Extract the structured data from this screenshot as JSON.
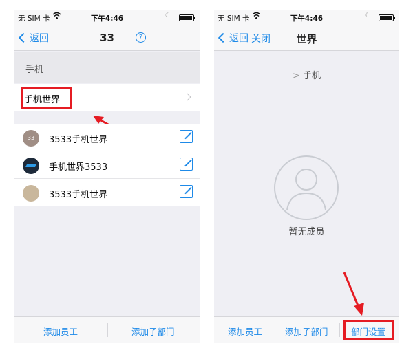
{
  "status_bar": {
    "carrier": "无 SIM 卡",
    "time": "下午4:46"
  },
  "left_screen": {
    "back_label": "返回",
    "title": "33",
    "breadcrumb": "手机",
    "department_name": "手机世界",
    "members": [
      {
        "avatar_text": "33",
        "name": "3533手机世界"
      },
      {
        "avatar_text": "",
        "name": "手机世界3533"
      },
      {
        "avatar_text": "",
        "name": "3533手机世界"
      }
    ],
    "bottom_buttons": [
      "添加员工",
      "添加子部门"
    ]
  },
  "right_screen": {
    "back_label": "返回",
    "close_label": "关闭",
    "title": "世界",
    "breadcrumb": "手机",
    "empty_text": "暂无成员",
    "bottom_buttons": [
      "添加员工",
      "添加子部门",
      "部门设置"
    ]
  },
  "colors": {
    "accent": "#1e8ae8",
    "highlight": "#e51c23"
  }
}
